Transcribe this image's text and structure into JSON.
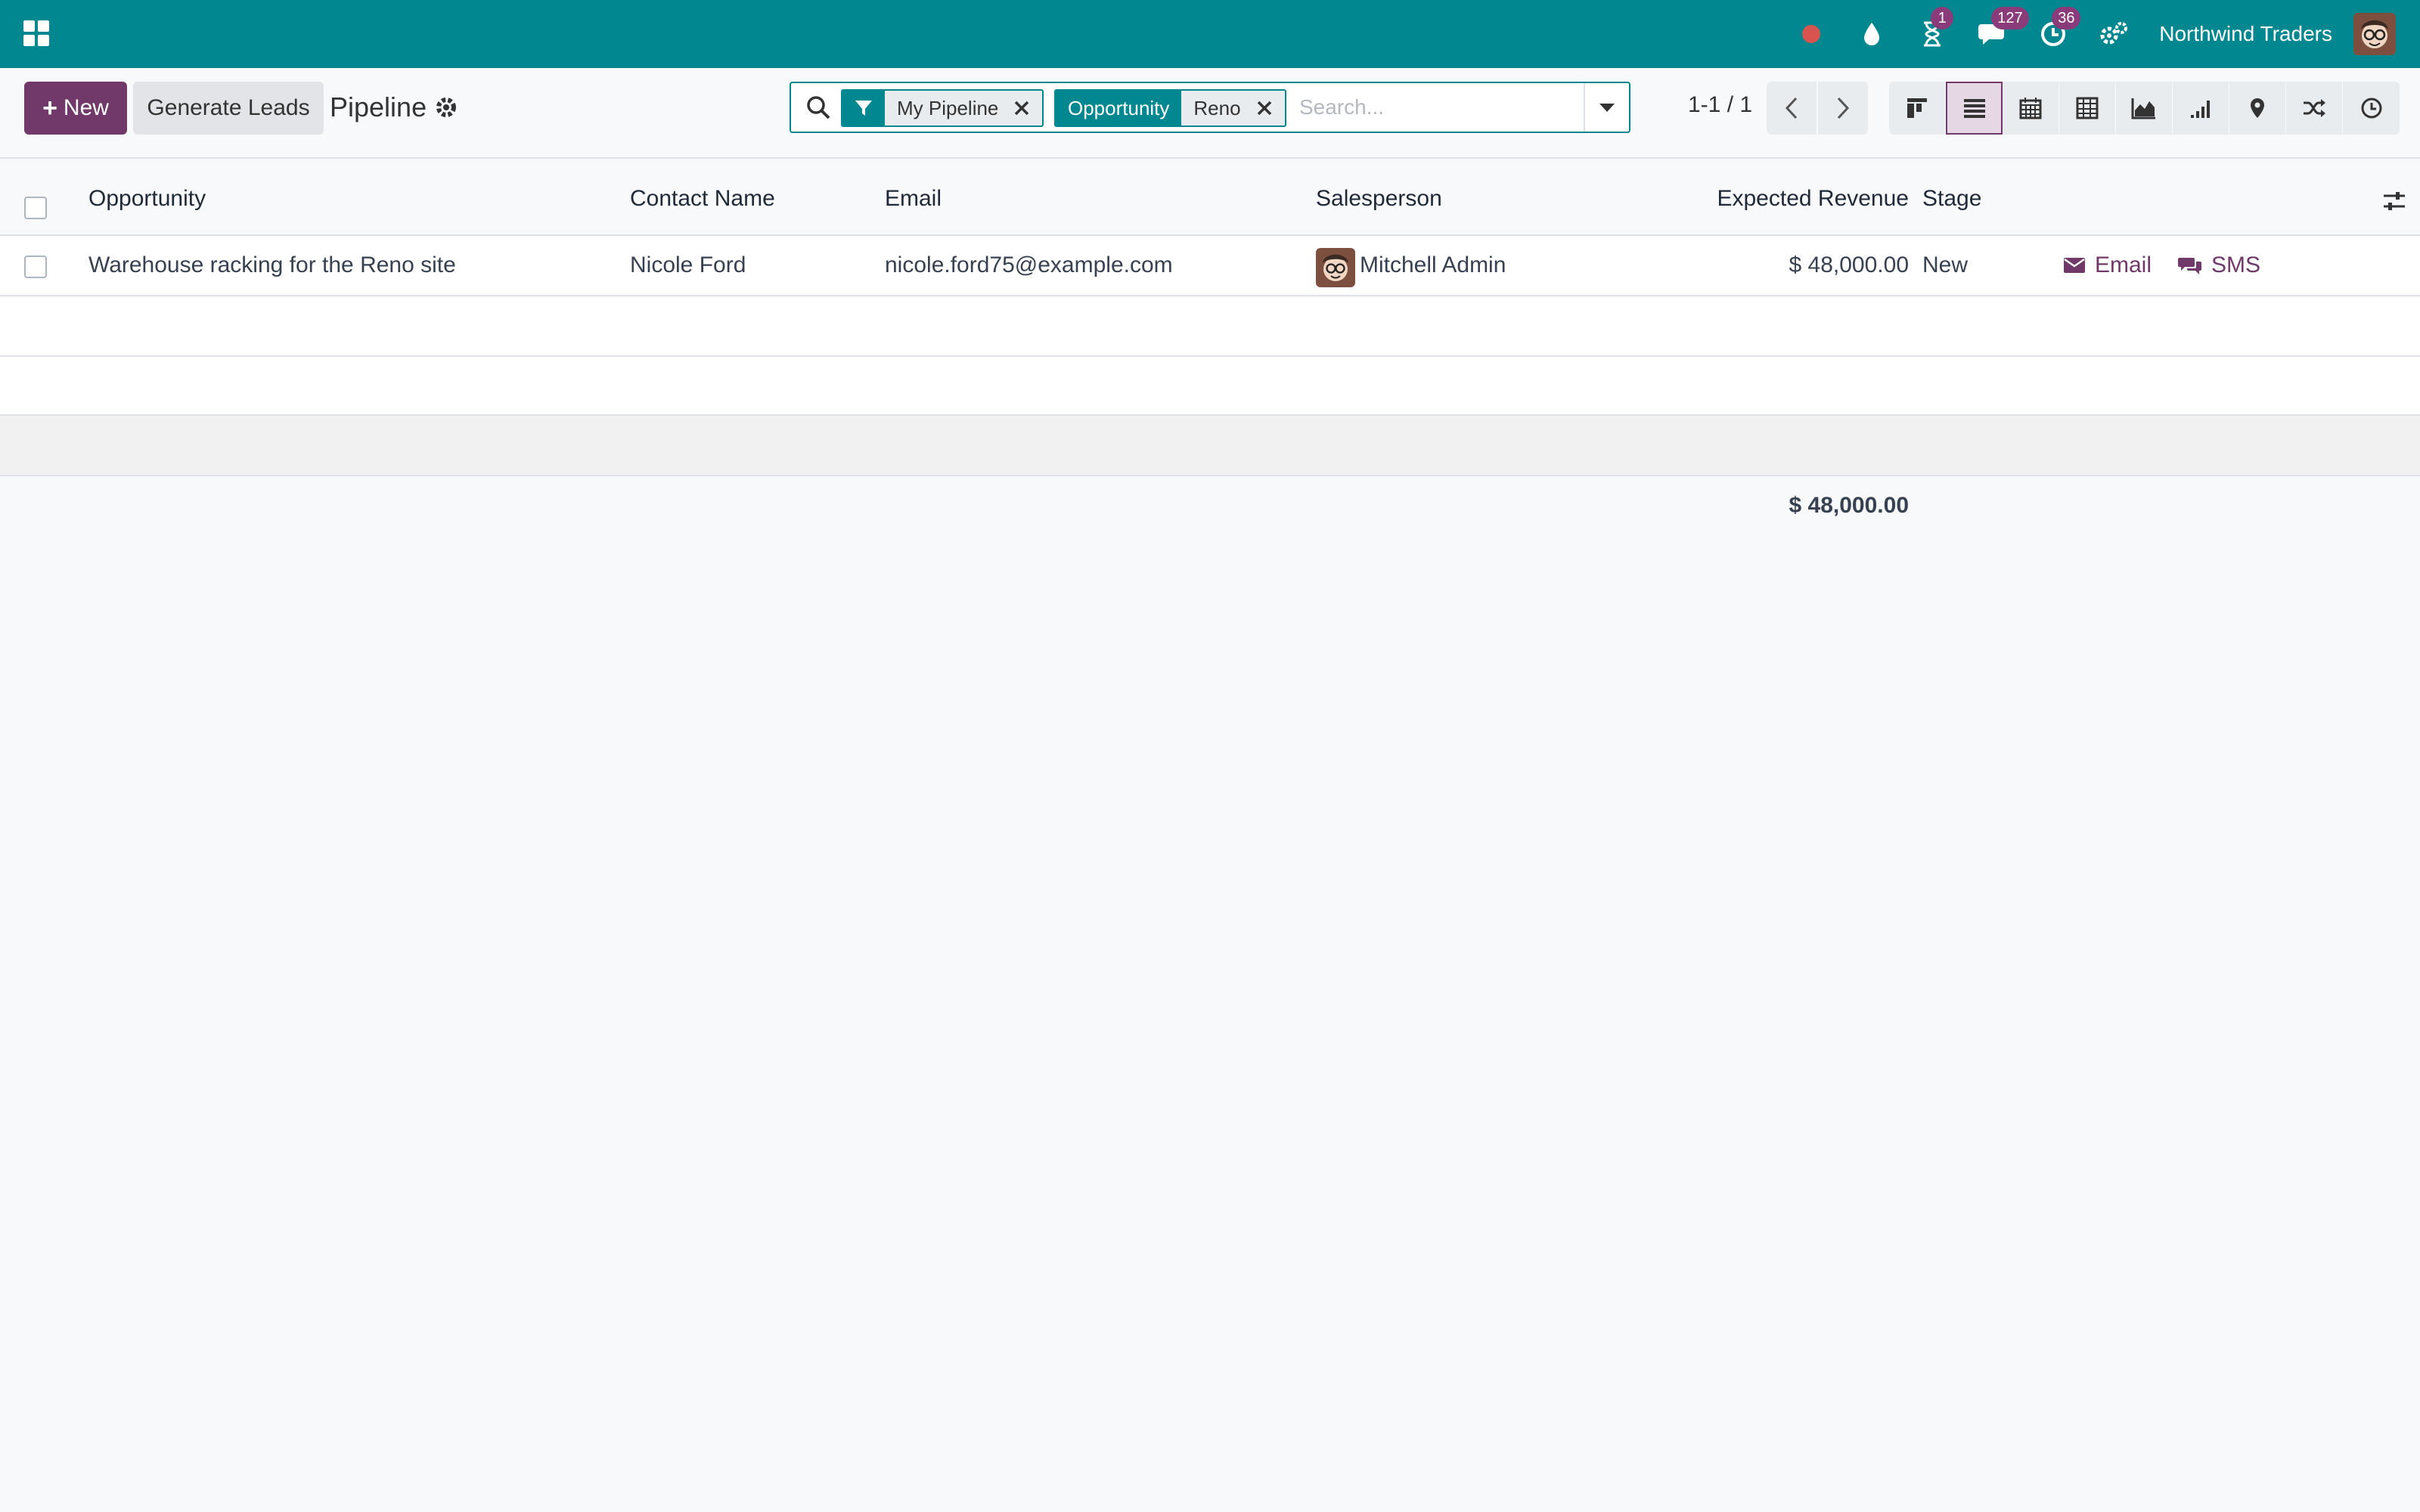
{
  "navbar": {
    "badges": {
      "activities": "1",
      "messages": "127",
      "clock": "36"
    },
    "company": "Northwind Traders",
    "colors": {
      "bar": "#01878f",
      "badge": "#8a3b7a",
      "record_dot": "#d9534f"
    }
  },
  "toolbar": {
    "new_label": "New",
    "generate_leads_label": "Generate Leads",
    "breadcrumb": "Pipeline"
  },
  "search": {
    "facets": [
      {
        "label_icon": "filter-icon",
        "value": "My Pipeline"
      },
      {
        "label": "Opportunity",
        "value": "Reno"
      }
    ],
    "placeholder": "Search..."
  },
  "pager": {
    "value": "1-1 / 1"
  },
  "views": [
    "kanban",
    "list",
    "calendar",
    "pivot",
    "graph",
    "cohort",
    "map",
    "activity",
    "recent"
  ],
  "active_view": "list",
  "table": {
    "columns": [
      "Opportunity",
      "Contact Name",
      "Email",
      "Salesperson",
      "Expected Revenue",
      "Stage"
    ],
    "rows": [
      {
        "opportunity": "Warehouse racking for the Reno site",
        "contact": "Nicole Ford",
        "email": "nicole.ford75@example.com",
        "salesperson": "Mitchell Admin",
        "revenue": "$ 48,000.00",
        "stage": "New",
        "actions": {
          "email": "Email",
          "sms": "SMS"
        }
      }
    ],
    "total": "$ 48,000.00"
  },
  "colors": {
    "accent": "#71396a",
    "teal": "#01878f"
  }
}
